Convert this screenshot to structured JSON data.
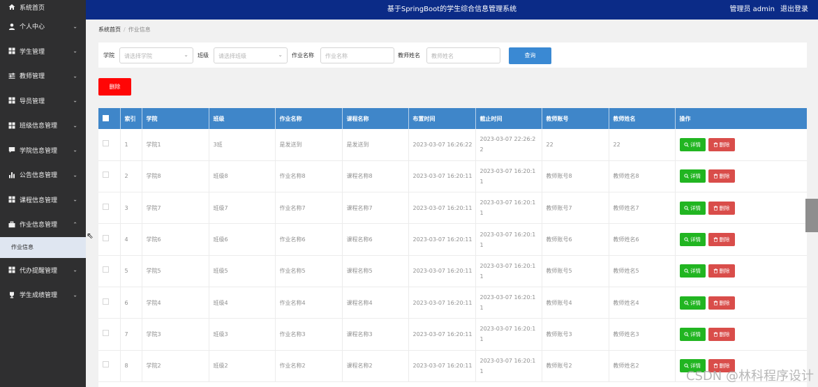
{
  "sidebar": {
    "items": [
      {
        "label": "系统首页",
        "icon": "home-icon"
      },
      {
        "label": "个人中心",
        "icon": "user-icon"
      },
      {
        "label": "学生管理",
        "icon": "grid-icon"
      },
      {
        "label": "教师管理",
        "icon": "sliders-icon"
      },
      {
        "label": "导员管理",
        "icon": "grid-icon"
      },
      {
        "label": "班级信息管理",
        "icon": "grid-icon"
      },
      {
        "label": "学院信息管理",
        "icon": "comment-icon"
      },
      {
        "label": "公告信息管理",
        "icon": "bar-chart-icon"
      },
      {
        "label": "课程信息管理",
        "icon": "grid-icon"
      },
      {
        "label": "作业信息管理",
        "icon": "briefcase-icon"
      },
      {
        "label": "代办提醒管理",
        "icon": "grid-icon"
      },
      {
        "label": "学生成绩管理",
        "icon": "trophy-icon"
      }
    ],
    "submenu": {
      "label": "作业信息"
    }
  },
  "header": {
    "title": "基于SpringBoot的学生综合信息管理系统",
    "admin": "管理员 admin",
    "logout": "退出登录"
  },
  "breadcrumb": {
    "home": "系统首页",
    "current": "作业信息"
  },
  "filter": {
    "college_label": "学院",
    "college_placeholder": "请选择学院",
    "class_label": "班级",
    "class_placeholder": "请选择班级",
    "homework_label": "作业名称",
    "homework_placeholder": "作业名称",
    "teacher_label": "教师姓名",
    "teacher_placeholder": "教师姓名",
    "query": "查询"
  },
  "delete_button": "删除",
  "table": {
    "headers": [
      "",
      "索引",
      "学院",
      "班级",
      "作业名称",
      "课程名称",
      "布置时间",
      "截止时间",
      "教师账号",
      "教师姓名",
      "操作"
    ],
    "detail_label": "详情",
    "delete_label": "删除",
    "rows": [
      {
        "index": "1",
        "college": "学院1",
        "class": "3班",
        "homework": "是发送到",
        "course": "是发送到",
        "assign": "2023-03-07 16:26:22",
        "deadline": "2023-03-07 22:26:22",
        "account": "22",
        "teacher": "22"
      },
      {
        "index": "2",
        "college": "学院8",
        "class": "班级8",
        "homework": "作业名称8",
        "course": "课程名称8",
        "assign": "2023-03-07 16:20:11",
        "deadline": "2023-03-07 16:20:11",
        "account": "教师账号8",
        "teacher": "教师姓名8"
      },
      {
        "index": "3",
        "college": "学院7",
        "class": "班级7",
        "homework": "作业名称7",
        "course": "课程名称7",
        "assign": "2023-03-07 16:20:11",
        "deadline": "2023-03-07 16:20:11",
        "account": "教师账号7",
        "teacher": "教师姓名7"
      },
      {
        "index": "4",
        "college": "学院6",
        "class": "班级6",
        "homework": "作业名称6",
        "course": "课程名称6",
        "assign": "2023-03-07 16:20:11",
        "deadline": "2023-03-07 16:20:11",
        "account": "教师账号6",
        "teacher": "教师姓名6"
      },
      {
        "index": "5",
        "college": "学院5",
        "class": "班级5",
        "homework": "作业名称5",
        "course": "课程名称5",
        "assign": "2023-03-07 16:20:11",
        "deadline": "2023-03-07 16:20:11",
        "account": "教师账号5",
        "teacher": "教师姓名5"
      },
      {
        "index": "6",
        "college": "学院4",
        "class": "班级4",
        "homework": "作业名称4",
        "course": "课程名称4",
        "assign": "2023-03-07 16:20:11",
        "deadline": "2023-03-07 16:20:11",
        "account": "教师账号4",
        "teacher": "教师姓名4"
      },
      {
        "index": "7",
        "college": "学院3",
        "class": "班级3",
        "homework": "作业名称3",
        "course": "课程名称3",
        "assign": "2023-03-07 16:20:11",
        "deadline": "2023-03-07 16:20:11",
        "account": "教师账号3",
        "teacher": "教师姓名3"
      },
      {
        "index": "8",
        "college": "学院2",
        "class": "班级2",
        "homework": "作业名称2",
        "course": "课程名称2",
        "assign": "2023-03-07 16:20:11",
        "deadline": "2023-03-07 16:20:11",
        "account": "教师账号2",
        "teacher": "教师姓名2"
      }
    ]
  },
  "watermark": "CSDN @林科程序设计",
  "colors": {
    "sidebar": "#2f2f30",
    "header": "#0b2b87",
    "table_header": "#3f86c9",
    "query": "#3a89d3",
    "delete": "#ff0606",
    "detail_btn": "#21b521",
    "row_delete_btn": "#d94d4a"
  }
}
